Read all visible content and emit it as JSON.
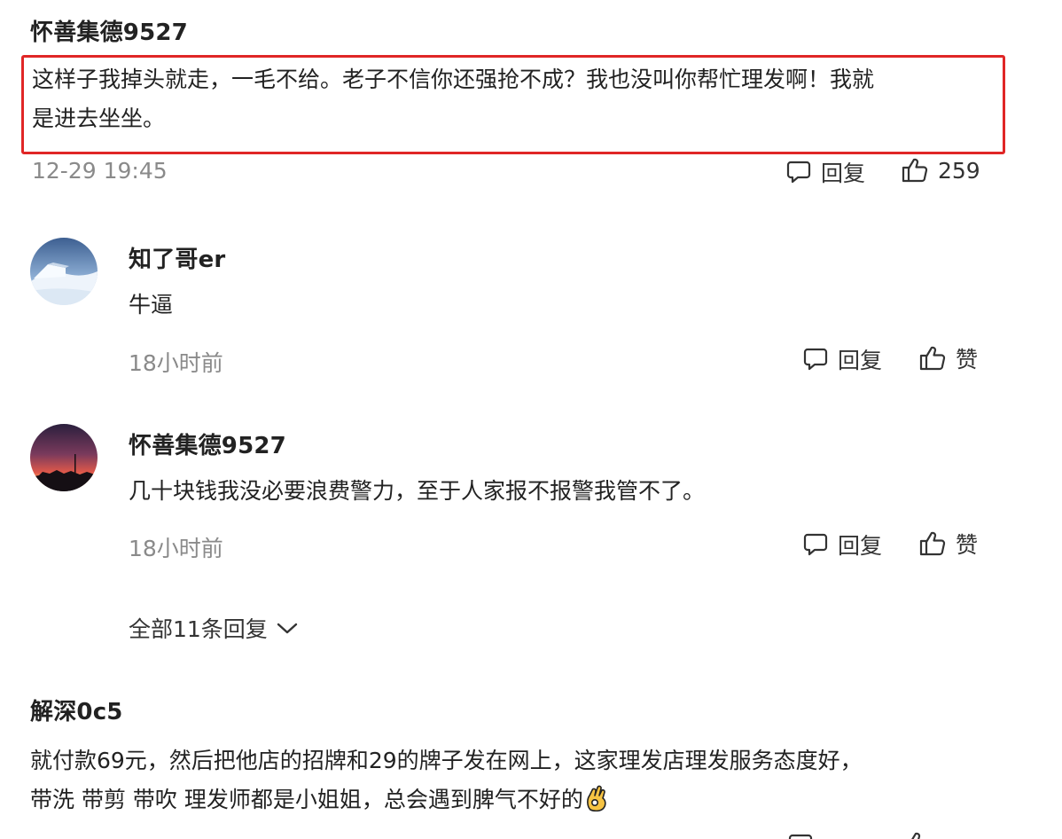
{
  "comments": [
    {
      "username": "怀善集德9527",
      "text_line1": "这样子我掉头就走，一毛不给。老子不信你还强抢不成？我也没叫你帮忙理发啊！我就",
      "text_line2": "是进去坐坐。",
      "time": "12-29 19:45",
      "reply_label": "回复",
      "like_count": "259",
      "highlighted": true,
      "highlight_color": "#e02626"
    },
    {
      "replies": [
        {
          "username": "知了哥er",
          "text": "牛逼",
          "time": "18小时前",
          "reply_label": "回复",
          "like_label": "赞",
          "avatar_icon": "snow-hill-avatar"
        },
        {
          "username": "怀善集德9527",
          "text": "几十块钱我没必要浪费警力，至于人家报不报警我管不了。",
          "time": "18小时前",
          "reply_label": "回复",
          "like_label": "赞",
          "avatar_icon": "sunset-avatar"
        }
      ],
      "expand_label": "全部11条回复"
    },
    {
      "username": "解深0c5",
      "text_line1": "就付款69元，然后把他店的招牌和29的牌子发在网上，这家理发店理发服务态度好，",
      "text_line2": "带洗 带剪 带吹 理发师都是小姐姐，总会遇到脾气不好的",
      "emoji_icon": "ok-hand-emoji"
    }
  ],
  "colors": {
    "meta": "#8a8a8a",
    "text": "#222222",
    "highlight": "#e02626"
  }
}
